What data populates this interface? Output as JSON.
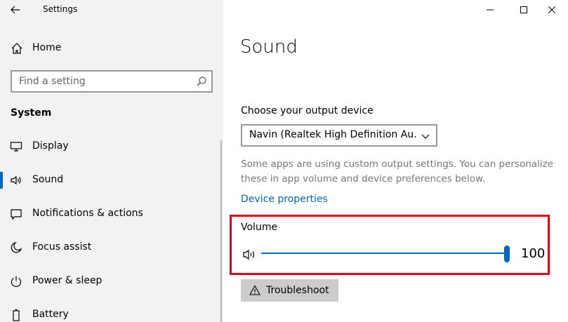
{
  "window": {
    "title": "Settings",
    "controls": [
      "minimize",
      "maximize",
      "close"
    ]
  },
  "sidebar": {
    "home_label": "Home",
    "search_placeholder": "Find a setting",
    "section_title": "System",
    "items": [
      {
        "label": "Display",
        "icon": "monitor-icon",
        "selected": false
      },
      {
        "label": "Sound",
        "icon": "speaker-icon",
        "selected": true
      },
      {
        "label": "Notifications & actions",
        "icon": "notification-icon",
        "selected": false
      },
      {
        "label": "Focus assist",
        "icon": "moon-icon",
        "selected": false
      },
      {
        "label": "Power & sleep",
        "icon": "power-icon",
        "selected": false
      },
      {
        "label": "Battery",
        "icon": "battery-icon",
        "selected": false
      }
    ]
  },
  "content": {
    "title": "Sound",
    "output_label": "Choose your output device",
    "output_device": "Navin (Realtek High Definition Au...",
    "note": "Some apps are using custom output settings. You can personalize these in app volume and device preferences below.",
    "device_properties_link": "Device properties",
    "volume_label": "Volume",
    "volume_value": "100",
    "volume_level": 100,
    "troubleshoot_label": "Troubleshoot"
  },
  "colors": {
    "accent": "#0067c0",
    "highlight_box": "#e0001b",
    "sidebar_bg": "#f2f2f2"
  }
}
